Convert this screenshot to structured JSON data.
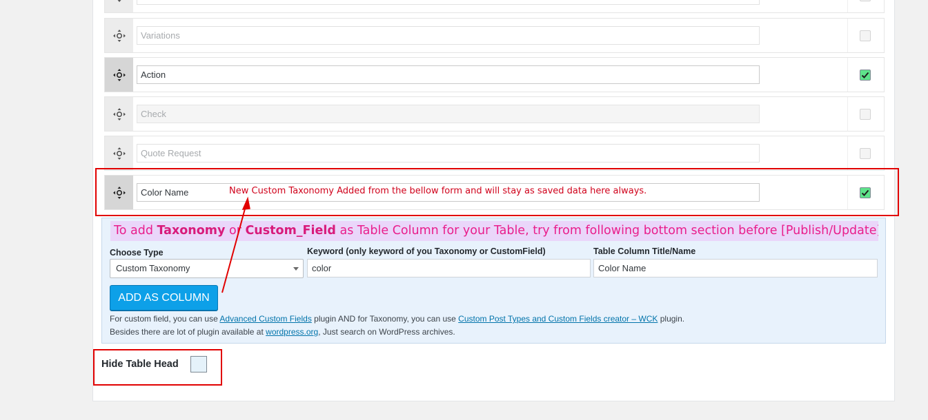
{
  "columns": [
    {
      "label": "",
      "checked": false,
      "active": false
    },
    {
      "label": "Variations",
      "checked": false,
      "active": false
    },
    {
      "label": "Action",
      "checked": true,
      "active": true
    },
    {
      "label": "Check",
      "checked": false,
      "active": false
    },
    {
      "label": "Quote Request",
      "checked": false,
      "active": false
    },
    {
      "label": "Color Name",
      "checked": true,
      "active": true
    }
  ],
  "annotation": {
    "note": "New Custom Taxonomy Added from the bellow form and will stay as saved data here always."
  },
  "taxonomy_form": {
    "headline_pre": "To add ",
    "headline_b1": "Taxonomy",
    "headline_mid": " or ",
    "headline_b2": "Custom_Field",
    "headline_post": " as Table Column for your Table, try from following bottom section before [Publish/Update] your post.",
    "choose_type_label": "Choose Type",
    "choose_type_value": "Custom Taxonomy",
    "keyword_label": "Keyword (only keyword of you Taxonomy or CustomField)",
    "keyword_value": "color",
    "title_label": "Table Column Title/Name",
    "title_value": "Color Name",
    "add_button": "ADD AS COLUMN",
    "help1_pre": "For custom field, you can use ",
    "help1_link1": "Advanced Custom Fields",
    "help1_mid": " plugin AND for Taxonomy, you can use ",
    "help1_link2": "Custom Post Types and Custom Fields creator – WCK",
    "help1_post": " plugin.",
    "help2_pre": "Besides there are lot of plugin available at ",
    "help2_link": "wordpress.org",
    "help2_post": ", Just search on WordPress archives."
  },
  "hide_table_head": {
    "label": "Hide Table Head",
    "checked": false
  },
  "colors": {
    "accent_red": "#e10000",
    "button_blue": "#0da0e8",
    "checkbox_green": "#5ee38a",
    "headline_pink": "#e91e8c"
  },
  "icons": {
    "drag": "move-arrows-icon",
    "check": "checkmark-icon"
  }
}
